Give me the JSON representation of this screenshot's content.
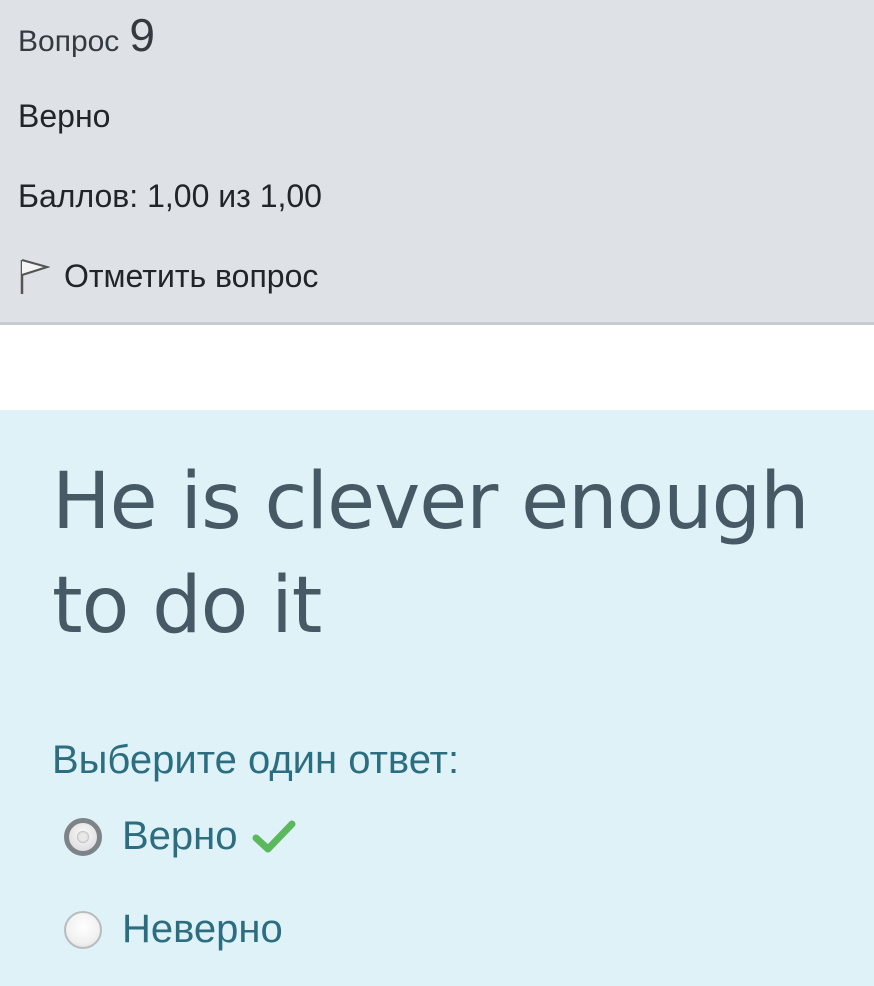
{
  "question_info": {
    "question_label": "Вопрос",
    "question_number": "9",
    "state": "Верно",
    "grade": "Баллов: 1,00 из 1,00",
    "flag_label": "Отметить вопрос",
    "flag_icon": "flag-icon"
  },
  "question": {
    "text": "He is clever enough to do it",
    "prompt": "Выберите один ответ:",
    "answers": [
      {
        "label": "Верно",
        "selected": true,
        "correct_icon": "checkmark-icon"
      },
      {
        "label": "Неверно",
        "selected": false
      }
    ]
  },
  "colors": {
    "info_bg": "#dee2e6",
    "content_bg": "#def2f8",
    "question_text": "#455a64",
    "answer_text": "#2c6e7f",
    "correct": "#5cb85c"
  }
}
